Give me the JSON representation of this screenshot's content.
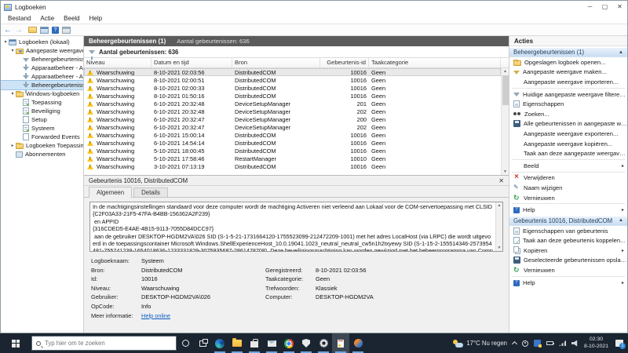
{
  "window": {
    "title": "Logboeken",
    "menu": [
      "Bestand",
      "Actie",
      "Beeld",
      "Help"
    ],
    "controls": [
      "minimize",
      "maximize",
      "close"
    ]
  },
  "toolbar": {
    "icons": [
      "back",
      "forward",
      "open-saved-log",
      "console-tree",
      "help-toolbar",
      "new-window"
    ]
  },
  "tree": {
    "items": [
      {
        "label": "Logboeken (lokaal)",
        "icon": "console",
        "depth": 0,
        "expander": "open"
      },
      {
        "label": "Aangepaste weergaven",
        "icon": "folder-filter",
        "depth": 1,
        "expander": "open"
      },
      {
        "label": "Beheergebeurtenissen",
        "icon": "filter",
        "depth": 2
      },
      {
        "label": "Apparaatbeheer - Algeme",
        "icon": "filter",
        "depth": 2
      },
      {
        "label": "Apparaatbeheer - Algeme",
        "icon": "filter",
        "depth": 2
      },
      {
        "label": "Beheergebeurtenissen (1)",
        "icon": "filter",
        "depth": 2,
        "selected": true
      },
      {
        "label": "Windows-logboeken",
        "icon": "folder",
        "depth": 1,
        "expander": "open"
      },
      {
        "label": "Toepassing",
        "icon": "log",
        "depth": 2
      },
      {
        "label": "Beveiliging",
        "icon": "log",
        "depth": 2
      },
      {
        "label": "Setup",
        "icon": "log-plain",
        "depth": 2
      },
      {
        "label": "Systeem",
        "icon": "log",
        "depth": 2
      },
      {
        "label": "Forwarded Events",
        "icon": "log-plain",
        "depth": 2
      },
      {
        "label": "Logboeken Toepassingen en",
        "icon": "folder",
        "depth": 1,
        "expander": "closed"
      },
      {
        "label": "Abonnementen",
        "icon": "subscription",
        "depth": 1
      }
    ]
  },
  "main": {
    "header_title": "Beheergebeurtenissen (1)",
    "header_count": "Aantal gebeurtenissen: 636",
    "filter_text": "Aantal gebeurtenissen: 636",
    "columns": [
      "Niveau",
      "Datum en tijd",
      "Bron",
      "Gebeurtenis-id",
      "Taakcategorie"
    ],
    "rows": [
      {
        "level": "Waarschuwing",
        "date": "8-10-2021 02:03:56",
        "source": "DistributedCOM",
        "id": "10016",
        "category": "Geen",
        "selected": true
      },
      {
        "level": "Waarschuwing",
        "date": "8-10-2021 02:00:51",
        "source": "DistributedCOM",
        "id": "10016",
        "category": "Geen"
      },
      {
        "level": "Waarschuwing",
        "date": "8-10-2021 02:00:33",
        "source": "DistributedCOM",
        "id": "10016",
        "category": "Geen"
      },
      {
        "level": "Waarschuwing",
        "date": "8-10-2021 01:50:16",
        "source": "DistributedCOM",
        "id": "10016",
        "category": "Geen"
      },
      {
        "level": "Waarschuwing",
        "date": "6-10-2021 20:32:48",
        "source": "DeviceSetupManager",
        "id": "201",
        "category": "Geen"
      },
      {
        "level": "Waarschuwing",
        "date": "6-10-2021 20:32:48",
        "source": "DeviceSetupManager",
        "id": "202",
        "category": "Geen"
      },
      {
        "level": "Waarschuwing",
        "date": "6-10-2021 20:32:47",
        "source": "DeviceSetupManager",
        "id": "200",
        "category": "Geen"
      },
      {
        "level": "Waarschuwing",
        "date": "6-10-2021 20:32:47",
        "source": "DeviceSetupManager",
        "id": "202",
        "category": "Geen"
      },
      {
        "level": "Waarschuwing",
        "date": "6-10-2021 15:00:14",
        "source": "DistributedCOM",
        "id": "10016",
        "category": "Geen"
      },
      {
        "level": "Waarschuwing",
        "date": "6-10-2021 14:54:14",
        "source": "DistributedCOM",
        "id": "10016",
        "category": "Geen"
      },
      {
        "level": "Waarschuwing",
        "date": "5-10-2021 18:00:45",
        "source": "DistributedCOM",
        "id": "10016",
        "category": "Geen"
      },
      {
        "level": "Waarschuwing",
        "date": "5-10-2021 17:58:46",
        "source": "RestartManager",
        "id": "10010",
        "category": "Geen"
      },
      {
        "level": "Waarschuwing",
        "date": "3-10-2021 07:13:19",
        "source": "DistributedCOM",
        "id": "10016",
        "category": "Geen"
      }
    ]
  },
  "detail": {
    "title": "Gebeurtenis 10016, DistributedCOM",
    "tabs": [
      {
        "label": "Algemeen",
        "active": true
      },
      {
        "label": "Details",
        "active": false
      }
    ],
    "description": "In de machtigingsinstellingen standaard voor deze computer wordt de machtiging Activeren niet verleend aan Lokaal voor de COM-servertoepassing met CLSID \n{C2F03A33-21F5-47FA-B4BB-156362A2F239}\n en APPID \n{316CDED5-E4AE-4B15-9113-7055D84DCC97}\n aan de gebruiker DESKTOP-HGDM2VA\\026 SID (S-1-5-21-1731664120-1755523099-212472209-1001) met het adres LocalHost (via LRPC) die wordt uitgevoerd in de toepassingscontainer Microsoft.Windows.ShellExperienceHost_10.0.19041.1023_neutral_neutral_cw5n1h2txyewy SID (S-1-15-2-155514346-2573954481-755741238-1654018636-1233331829-3075935687-2861478708). Deze beveiligingsmachtiging kan worden gewijzigd met het beheerprogramma van Component Services.",
    "fields": [
      {
        "ll": "Logboeknaam:",
        "lv": "Systeem",
        "rl": "",
        "rv": ""
      },
      {
        "ll": "Bron:",
        "lv": "DistributedCOM",
        "rl": "Geregistreerd:",
        "rv": "8-10-2021 02:03:56"
      },
      {
        "ll": "Id:",
        "lv": "10016",
        "rl": "Taakcategorie:",
        "rv": "Geen"
      },
      {
        "ll": "Niveau:",
        "lv": "Waarschuwing",
        "rl": "Trefwoorden:",
        "rv": "Klassiek"
      },
      {
        "ll": "Gebruiker:",
        "lv": "DESKTOP-HGDM2VA\\026",
        "rl": "Computer:",
        "rv": "DESKTOP-HGDM2VA"
      },
      {
        "ll": "OpCode:",
        "lv": "Info",
        "rl": "",
        "rv": ""
      },
      {
        "ll": "Meer informatie:",
        "lv": "Help online",
        "link": true,
        "rl": "",
        "rv": ""
      }
    ]
  },
  "actions": {
    "title": "Acties",
    "sections": [
      {
        "header": "Beheergebeurtenissen (1)",
        "items": [
          {
            "label": "Opgeslagen logboek openen...",
            "icon": "open-folder",
            "name": "open-saved-log"
          },
          {
            "label": "Aangepaste weergave maken...",
            "icon": "filter-create",
            "name": "create-custom-view"
          },
          {
            "label": "Aangepaste weergave importeren...",
            "icon": "none",
            "name": "import-custom-view"
          },
          {
            "type": "sep"
          },
          {
            "label": "Huidige aangepaste weergave filteren...",
            "icon": "filter",
            "name": "filter-current-view"
          },
          {
            "label": "Eigenschappen",
            "icon": "properties",
            "name": "properties"
          },
          {
            "label": "Zoeken...",
            "icon": "find",
            "name": "find"
          },
          {
            "label": "Alle gebeurtenissen in aangepaste weerga...",
            "icon": "save",
            "name": "save-all-events"
          },
          {
            "label": "Aangepaste weergave exporteren...",
            "icon": "none",
            "name": "export-custom-view"
          },
          {
            "label": "Aangepaste weergave kopiëren...",
            "icon": "none",
            "name": "copy-custom-view"
          },
          {
            "label": "Taak aan deze aangepaste weergave kopp...",
            "icon": "none",
            "name": "attach-task-to-view"
          },
          {
            "type": "sep"
          },
          {
            "label": "Beeld",
            "icon": "none",
            "name": "view-menu",
            "submenu": true
          },
          {
            "type": "sep"
          },
          {
            "label": "Verwijderen",
            "icon": "delete",
            "name": "delete"
          },
          {
            "label": "Naam wijzigen",
            "icon": "rename",
            "name": "rename"
          },
          {
            "label": "Vernieuwen",
            "icon": "refresh",
            "name": "refresh"
          },
          {
            "type": "sep"
          },
          {
            "label": "Help",
            "icon": "help",
            "name": "help",
            "submenu": true
          }
        ]
      },
      {
        "header": "Gebeurtenis 10016, DistributedCOM",
        "items": [
          {
            "label": "Eigenschappen van gebeurtenis",
            "icon": "properties",
            "name": "event-properties"
          },
          {
            "label": "Taak aan deze gebeurtenis koppelen...",
            "icon": "task",
            "name": "attach-task-to-event"
          },
          {
            "label": "Kopiëren",
            "icon": "copy",
            "name": "copy",
            "submenu": true
          },
          {
            "label": "Geselecteerde gebeurtenissen opslaan...",
            "icon": "save",
            "name": "save-selected-events"
          },
          {
            "label": "Vernieuwen",
            "icon": "refresh",
            "name": "refresh-event"
          },
          {
            "type": "sep"
          },
          {
            "label": "Help",
            "icon": "help",
            "name": "help-event",
            "submenu": true
          }
        ]
      }
    ]
  },
  "taskbar": {
    "search_placeholder": "Typ hier om te zoeken",
    "apps": [
      {
        "name": "cortana",
        "glyph": "cortana-ring"
      },
      {
        "name": "task-view",
        "glyph": "taskview-glyph"
      },
      {
        "name": "edge",
        "glyph": "edge-glyph",
        "running": true
      },
      {
        "name": "file-explorer",
        "glyph": "explorer-glyph",
        "running": true
      },
      {
        "name": "store",
        "glyph": "store-glyph",
        "running": true
      },
      {
        "name": "mail",
        "glyph": "mail-glyph",
        "running": true
      },
      {
        "name": "chrome",
        "glyph": "chrome-glyph",
        "running": true
      },
      {
        "name": "windows-security",
        "glyph": "shield-glyph",
        "running": true
      },
      {
        "name": "settings",
        "glyph": "gear-glyph",
        "running": true
      },
      {
        "name": "event-viewer",
        "glyph": "ev-glyph",
        "running": true,
        "active": true
      },
      {
        "name": "pinned-app",
        "glyph": "pin-glyph",
        "running": true
      }
    ],
    "weather": "17°C  Nu regen",
    "time": "02:30",
    "date": "8-10-2021",
    "notification_badge": "1"
  }
}
